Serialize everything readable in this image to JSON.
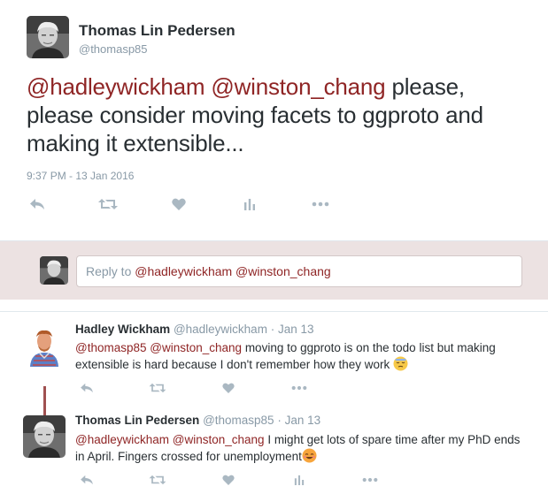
{
  "main_tweet": {
    "author_name": "Thomas Lin Pedersen",
    "author_handle": "@thomasp85",
    "mention_1": "@hadleywickham",
    "mention_2": "@winston_chang",
    "text_line_1": "please,",
    "text_rest": "please consider moving facets to ggproto and making it extensible...",
    "timestamp": "9:37 PM - 13 Jan 2016",
    "actions": [
      "reply-icon",
      "retweet-icon",
      "like-icon",
      "analytics-icon",
      "more-icon"
    ]
  },
  "reply_box": {
    "prefix": "Reply to ",
    "mentions": "@hadleywickham @winston_chang"
  },
  "replies": [
    {
      "author_name": "Hadley Wickham",
      "author_handle": "@hadleywickham",
      "separator": "·",
      "date": "Jan 13",
      "mention_1": "@thomasp85",
      "mention_2": "@winston_chang",
      "text": "moving to ggproto is on the todo list but making extensible is hard because I don't remember how they work",
      "emoji": "sleepy-face-emoji",
      "actions": [
        "reply-icon",
        "retweet-icon",
        "like-icon",
        "more-icon"
      ]
    },
    {
      "author_name": "Thomas Lin Pedersen",
      "author_handle": "@thomasp85",
      "separator": "·",
      "date": "Jan 13",
      "mention_1": "@hadleywickham",
      "mention_2": "@winston_chang",
      "text": "I might get lots of spare time after my PhD ends in April. Fingers crossed for unemployment",
      "emoji": "smiling-face-emoji",
      "actions": [
        "reply-icon",
        "retweet-icon",
        "like-icon",
        "analytics-icon",
        "more-icon"
      ]
    }
  ],
  "colors": {
    "mention": "#8f2525",
    "muted": "#8899a6",
    "text": "#292f33",
    "reply_bg": "#ece2e2",
    "thread_line": "#a05050"
  }
}
